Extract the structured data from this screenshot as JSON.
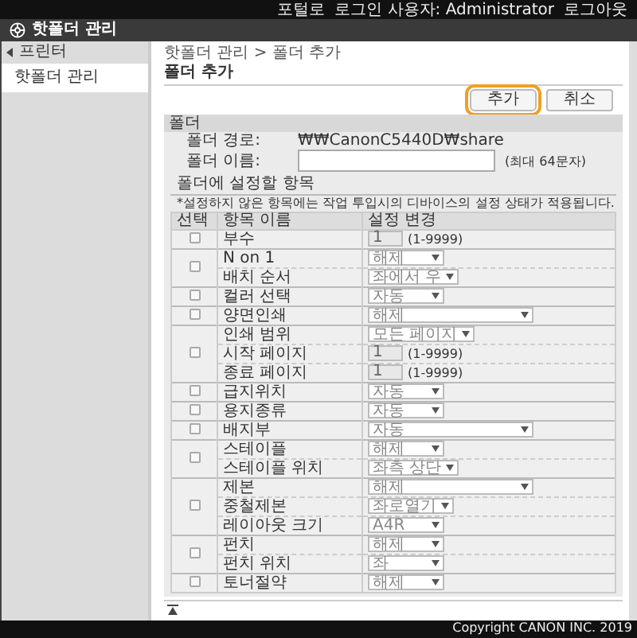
{
  "top_bar": {
    "portal_link": "포털로",
    "user_label": "로그인 사용자: Administrator",
    "logout_link": "로그아웃"
  },
  "app_title": "핫폴더 관리",
  "sidebar": {
    "items": [
      {
        "label": "프린터",
        "kind": "back",
        "selected": false
      },
      {
        "label": "핫폴더 관리",
        "kind": "page",
        "selected": true
      }
    ]
  },
  "breadcrumb": "핫폴더 관리 > 폴더 추가",
  "page_title": "폴더 추가",
  "buttons": [
    {
      "label": "추가",
      "highlighted": true
    },
    {
      "label": "취소",
      "highlighted": false
    }
  ],
  "folder": {
    "title": "폴더",
    "path_label": "폴더 경로:",
    "path_value": "₩₩CanonC5440D₩share",
    "name_label": "폴더 이름:",
    "name_hint": "(최대 64문자)"
  },
  "settings": {
    "title": "폴더에 설정할 항목",
    "note": "*설정하지 않은 항목에는 작업 투입시의 디바이스의 설정 상태가 적용됩니다.",
    "columns": [
      "선택",
      "항목 이름",
      "설정 변경"
    ],
    "groups": [
      {
        "checked": false,
        "items": [
          {
            "label": "부수",
            "kind": "number",
            "value": "1",
            "hint": "(1-9999)"
          }
        ]
      },
      {
        "checked": false,
        "items": [
          {
            "label": "N on 1",
            "kind": "select",
            "value": "해제"
          },
          {
            "label": "배치 순서",
            "kind": "select",
            "value": "좌에서 우"
          }
        ]
      },
      {
        "checked": false,
        "items": [
          {
            "label": "컬러 선택",
            "kind": "select",
            "value": "자동"
          }
        ]
      },
      {
        "checked": false,
        "items": [
          {
            "label": "양면인쇄",
            "kind": "wide-select",
            "value": "해제"
          }
        ]
      },
      {
        "checked": false,
        "items": [
          {
            "label": "인쇄 범위",
            "kind": "select",
            "value": "모든 페이지"
          },
          {
            "label": "시작 페이지",
            "kind": "number",
            "value": "1",
            "hint": "(1-9999)"
          },
          {
            "label": "종료 페이지",
            "kind": "number",
            "value": "1",
            "hint": "(1-9999)"
          }
        ]
      },
      {
        "checked": false,
        "items": [
          {
            "label": "급지위치",
            "kind": "select",
            "value": "자동"
          }
        ]
      },
      {
        "checked": false,
        "items": [
          {
            "label": "용지종류",
            "kind": "select",
            "value": "자동"
          }
        ]
      },
      {
        "checked": false,
        "items": [
          {
            "label": "배지부",
            "kind": "wide-select",
            "value": "자동"
          }
        ]
      },
      {
        "checked": false,
        "items": [
          {
            "label": "스테이플",
            "kind": "select",
            "value": "해제"
          },
          {
            "label": "스테이플 위치",
            "kind": "select",
            "value": "좌측 상단"
          }
        ]
      },
      {
        "checked": false,
        "items": [
          {
            "label": "제본",
            "kind": "wide-select",
            "value": "해제"
          },
          {
            "label": "중철제본",
            "kind": "select",
            "value": "좌로열기"
          },
          {
            "label": "레이아웃 크기",
            "kind": "select",
            "value": "A4R"
          }
        ]
      },
      {
        "checked": false,
        "items": [
          {
            "label": "펀치",
            "kind": "select",
            "value": "해제"
          },
          {
            "label": "펀치 위치",
            "kind": "select",
            "value": "좌"
          }
        ]
      },
      {
        "checked": false,
        "items": [
          {
            "label": "토너절약",
            "kind": "select",
            "value": "해제"
          }
        ]
      }
    ]
  },
  "copyright": "Copyright CANON INC. 2019"
}
